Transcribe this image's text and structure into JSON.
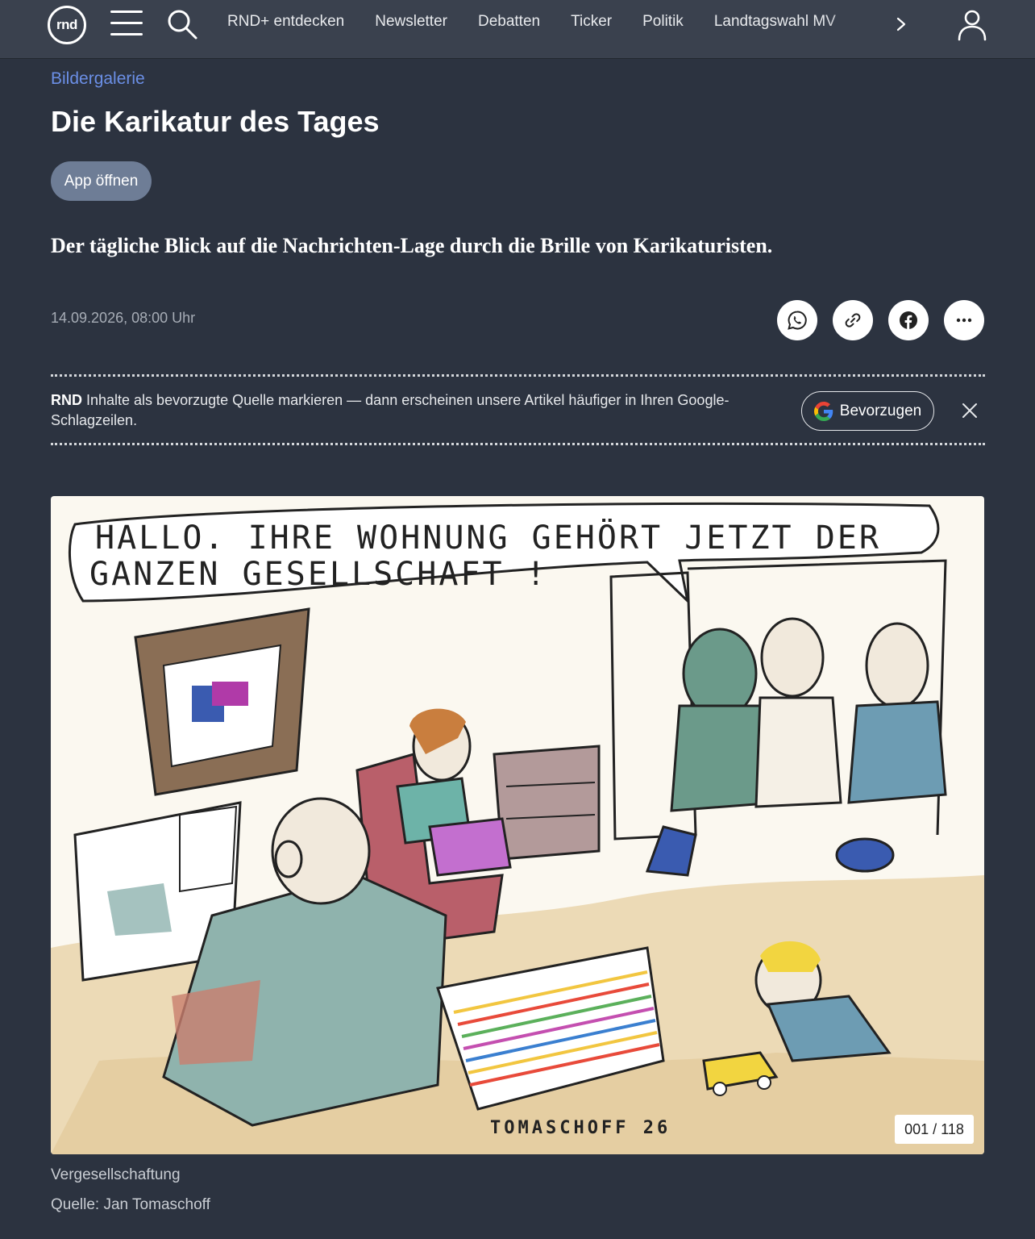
{
  "header": {
    "logo_text": "rnd",
    "nav": [
      "RND+ entdecken",
      "Newsletter",
      "Debatten",
      "Ticker",
      "Politik",
      "Landtagswahl MV"
    ]
  },
  "article": {
    "kicker": "Bildergalerie",
    "title": "Die Karikatur des Tages",
    "app_button": "App öffnen",
    "teaser": "Der tägliche Blick auf die Nachrichten-Lage durch die Brille von Karikaturisten.",
    "date": "14.09.2026, 08:00 Uhr"
  },
  "share_icons": [
    "whatsapp-icon",
    "link-icon",
    "facebook-icon",
    "more-icon"
  ],
  "preferred_source": {
    "brand": "RND",
    "text": " Inhalte als bevorzugte Quelle markieren — dann erscheinen unsere Artikel häufiger in Ihren Google-Schlagzeilen.",
    "button": "Bevorzugen"
  },
  "gallery": {
    "speech_line1": "HALLO. IHRE WOHNUNG GEHÖRT JETZT DER",
    "speech_line2": "GANZEN GESELLSCHAFT !",
    "signature": "TOMASCHOFF 26",
    "counter": "001 / 118",
    "caption": "Vergesellschaftung",
    "source": "Quelle: Jan Tomaschoff"
  },
  "colors": {
    "background": "#2c3340",
    "header": "#3a414e",
    "kicker": "#6b8fe6",
    "app_button": "#6e7d96"
  }
}
